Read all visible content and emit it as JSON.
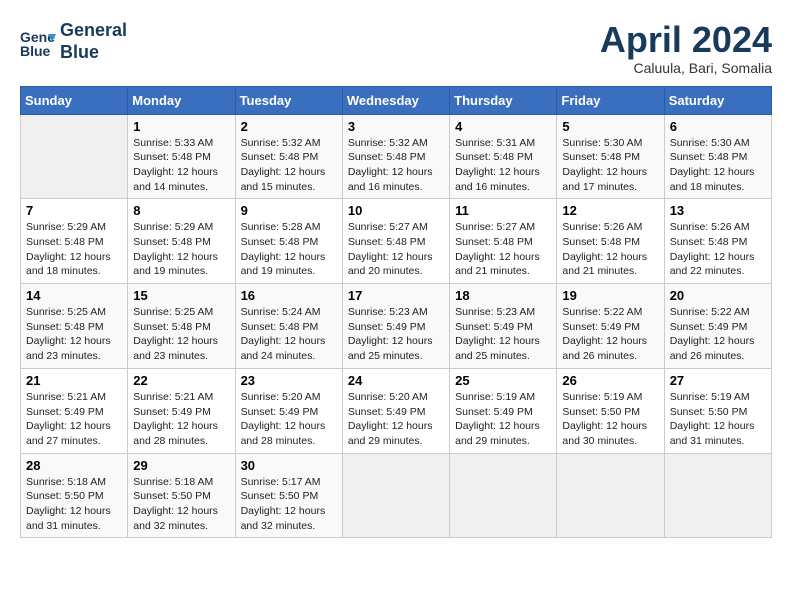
{
  "header": {
    "logo_line1": "General",
    "logo_line2": "Blue",
    "month_year": "April 2024",
    "location": "Caluula, Bari, Somalia"
  },
  "days_of_week": [
    "Sunday",
    "Monday",
    "Tuesday",
    "Wednesday",
    "Thursday",
    "Friday",
    "Saturday"
  ],
  "weeks": [
    [
      {
        "num": "",
        "info": ""
      },
      {
        "num": "1",
        "info": "Sunrise: 5:33 AM\nSunset: 5:48 PM\nDaylight: 12 hours\nand 14 minutes."
      },
      {
        "num": "2",
        "info": "Sunrise: 5:32 AM\nSunset: 5:48 PM\nDaylight: 12 hours\nand 15 minutes."
      },
      {
        "num": "3",
        "info": "Sunrise: 5:32 AM\nSunset: 5:48 PM\nDaylight: 12 hours\nand 16 minutes."
      },
      {
        "num": "4",
        "info": "Sunrise: 5:31 AM\nSunset: 5:48 PM\nDaylight: 12 hours\nand 16 minutes."
      },
      {
        "num": "5",
        "info": "Sunrise: 5:30 AM\nSunset: 5:48 PM\nDaylight: 12 hours\nand 17 minutes."
      },
      {
        "num": "6",
        "info": "Sunrise: 5:30 AM\nSunset: 5:48 PM\nDaylight: 12 hours\nand 18 minutes."
      }
    ],
    [
      {
        "num": "7",
        "info": "Sunrise: 5:29 AM\nSunset: 5:48 PM\nDaylight: 12 hours\nand 18 minutes."
      },
      {
        "num": "8",
        "info": "Sunrise: 5:29 AM\nSunset: 5:48 PM\nDaylight: 12 hours\nand 19 minutes."
      },
      {
        "num": "9",
        "info": "Sunrise: 5:28 AM\nSunset: 5:48 PM\nDaylight: 12 hours\nand 19 minutes."
      },
      {
        "num": "10",
        "info": "Sunrise: 5:27 AM\nSunset: 5:48 PM\nDaylight: 12 hours\nand 20 minutes."
      },
      {
        "num": "11",
        "info": "Sunrise: 5:27 AM\nSunset: 5:48 PM\nDaylight: 12 hours\nand 21 minutes."
      },
      {
        "num": "12",
        "info": "Sunrise: 5:26 AM\nSunset: 5:48 PM\nDaylight: 12 hours\nand 21 minutes."
      },
      {
        "num": "13",
        "info": "Sunrise: 5:26 AM\nSunset: 5:48 PM\nDaylight: 12 hours\nand 22 minutes."
      }
    ],
    [
      {
        "num": "14",
        "info": "Sunrise: 5:25 AM\nSunset: 5:48 PM\nDaylight: 12 hours\nand 23 minutes."
      },
      {
        "num": "15",
        "info": "Sunrise: 5:25 AM\nSunset: 5:48 PM\nDaylight: 12 hours\nand 23 minutes."
      },
      {
        "num": "16",
        "info": "Sunrise: 5:24 AM\nSunset: 5:48 PM\nDaylight: 12 hours\nand 24 minutes."
      },
      {
        "num": "17",
        "info": "Sunrise: 5:23 AM\nSunset: 5:49 PM\nDaylight: 12 hours\nand 25 minutes."
      },
      {
        "num": "18",
        "info": "Sunrise: 5:23 AM\nSunset: 5:49 PM\nDaylight: 12 hours\nand 25 minutes."
      },
      {
        "num": "19",
        "info": "Sunrise: 5:22 AM\nSunset: 5:49 PM\nDaylight: 12 hours\nand 26 minutes."
      },
      {
        "num": "20",
        "info": "Sunrise: 5:22 AM\nSunset: 5:49 PM\nDaylight: 12 hours\nand 26 minutes."
      }
    ],
    [
      {
        "num": "21",
        "info": "Sunrise: 5:21 AM\nSunset: 5:49 PM\nDaylight: 12 hours\nand 27 minutes."
      },
      {
        "num": "22",
        "info": "Sunrise: 5:21 AM\nSunset: 5:49 PM\nDaylight: 12 hours\nand 28 minutes."
      },
      {
        "num": "23",
        "info": "Sunrise: 5:20 AM\nSunset: 5:49 PM\nDaylight: 12 hours\nand 28 minutes."
      },
      {
        "num": "24",
        "info": "Sunrise: 5:20 AM\nSunset: 5:49 PM\nDaylight: 12 hours\nand 29 minutes."
      },
      {
        "num": "25",
        "info": "Sunrise: 5:19 AM\nSunset: 5:49 PM\nDaylight: 12 hours\nand 29 minutes."
      },
      {
        "num": "26",
        "info": "Sunrise: 5:19 AM\nSunset: 5:50 PM\nDaylight: 12 hours\nand 30 minutes."
      },
      {
        "num": "27",
        "info": "Sunrise: 5:19 AM\nSunset: 5:50 PM\nDaylight: 12 hours\nand 31 minutes."
      }
    ],
    [
      {
        "num": "28",
        "info": "Sunrise: 5:18 AM\nSunset: 5:50 PM\nDaylight: 12 hours\nand 31 minutes."
      },
      {
        "num": "29",
        "info": "Sunrise: 5:18 AM\nSunset: 5:50 PM\nDaylight: 12 hours\nand 32 minutes."
      },
      {
        "num": "30",
        "info": "Sunrise: 5:17 AM\nSunset: 5:50 PM\nDaylight: 12 hours\nand 32 minutes."
      },
      {
        "num": "",
        "info": ""
      },
      {
        "num": "",
        "info": ""
      },
      {
        "num": "",
        "info": ""
      },
      {
        "num": "",
        "info": ""
      }
    ]
  ]
}
